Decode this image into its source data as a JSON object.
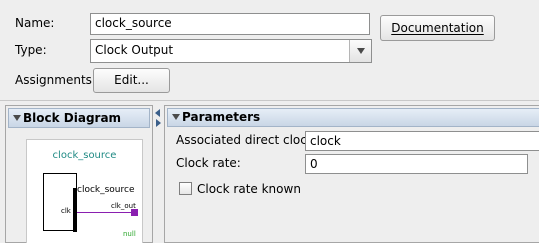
{
  "form": {
    "name_label": "Name:",
    "name_value": "clock_source",
    "type_label": "Type:",
    "type_value": "Clock Output",
    "assignments_label": "Assignments:",
    "edit_button": "Edit...",
    "documentation_button": "Documentation"
  },
  "block_diagram": {
    "title": "Block Diagram",
    "module_name": "clock_source",
    "instance_name": "clock_source",
    "port_clk": "clk",
    "port_clk_out": "clk_out",
    "null_label": "null"
  },
  "parameters": {
    "title": "Parameters",
    "associated_clock_label": "Associated direct clock:",
    "associated_clock_value": "clock",
    "clock_rate_label": "Clock rate:",
    "clock_rate_value": "0",
    "clock_rate_known_label": "Clock rate known",
    "clock_rate_known_checked": false
  },
  "colors": {
    "module_text": "#1f8a84",
    "wire": "#8a1fb0",
    "null_text": "#2aa52a"
  }
}
